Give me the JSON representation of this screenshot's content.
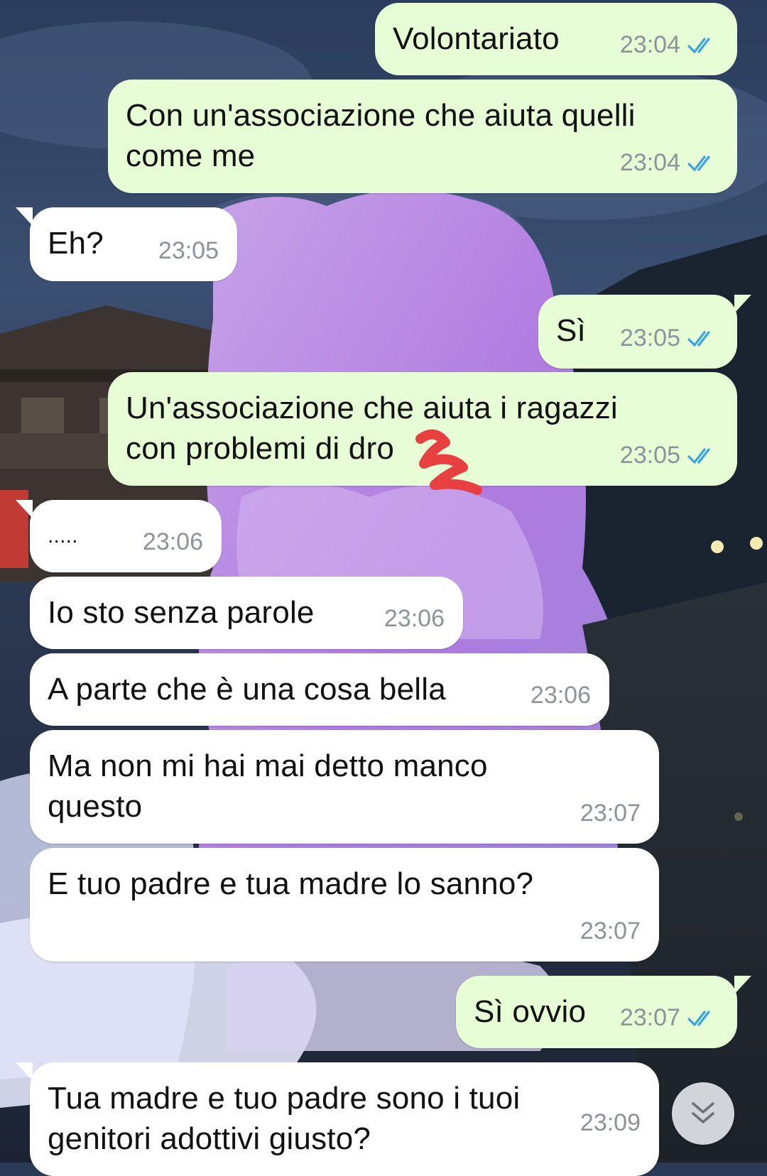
{
  "messages": [
    {
      "text": "Volontariato",
      "time": "23:04",
      "direction": "out"
    },
    {
      "text": "Con un'associazione che aiuta quelli come me",
      "line1": "Con un'associazione che aiuta quelli",
      "line2": "come me",
      "time": "23:04",
      "direction": "out"
    },
    {
      "text": "Eh?",
      "time": "23:05",
      "direction": "in"
    },
    {
      "text": "Sì",
      "time": "23:05",
      "direction": "out"
    },
    {
      "text": "Un'associazione che aiuta i ragazzi con problemi di dro",
      "line1": "Un'associazione che aiuta i ragazzi",
      "line2": "con problemi di dro",
      "time": "23:05",
      "direction": "out"
    },
    {
      "text": ".....",
      "time": "23:06",
      "direction": "in"
    },
    {
      "text": "Io sto senza parole",
      "time": "23:06",
      "direction": "in"
    },
    {
      "text": "A parte che è una cosa bella",
      "time": "23:06",
      "direction": "in"
    },
    {
      "text": "Ma non mi hai mai detto manco questo",
      "line1": "Ma non mi hai mai detto manco",
      "line2": "questo",
      "time": "23:07",
      "direction": "in"
    },
    {
      "text": "E tuo padre e tua madre lo sanno?",
      "time": "23:07",
      "direction": "in"
    },
    {
      "text": "Sì ovvio",
      "time": "23:07",
      "direction": "out"
    },
    {
      "text": "Tua madre e tuo padre sono i tuoi genitori adottivi giusto?",
      "line1": "Tua madre e tuo padre sono i tuoi",
      "line2": "genitori adottivi giusto?",
      "time": "23:09",
      "direction": "in"
    }
  ],
  "icons": {
    "read_receipt": "double-check-icon",
    "scroll_down": "chevron-double-down-icon"
  },
  "colors": {
    "outgoing_bubble": "#e7fdd6",
    "incoming_bubble": "#ffffff",
    "timestamp": "#8c9399",
    "read_check": "#3aa3e8",
    "scribble": "#e84040"
  }
}
